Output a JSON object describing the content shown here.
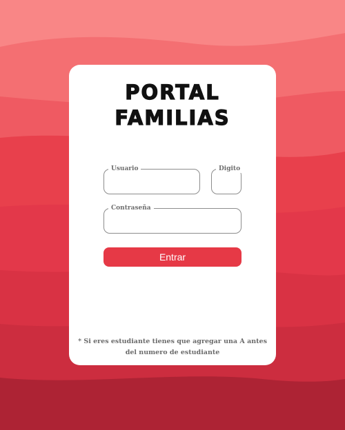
{
  "title": {
    "line1": "PORTAL",
    "line2": "FAMILIAS"
  },
  "form": {
    "usuario_label": "Usuario",
    "usuario_value": "",
    "digito_label": "Digito",
    "digito_value": "",
    "password_label": "Contraseña",
    "password_value": "",
    "submit_label": "Entrar"
  },
  "footer": {
    "note": "* Si eres estudiante tienes que agregar una A antes del numero de estudiante"
  },
  "colors": {
    "accent": "#e63946",
    "background_top": "#f98888",
    "background_bottom": "#ab2335",
    "card": "#ffffff"
  }
}
